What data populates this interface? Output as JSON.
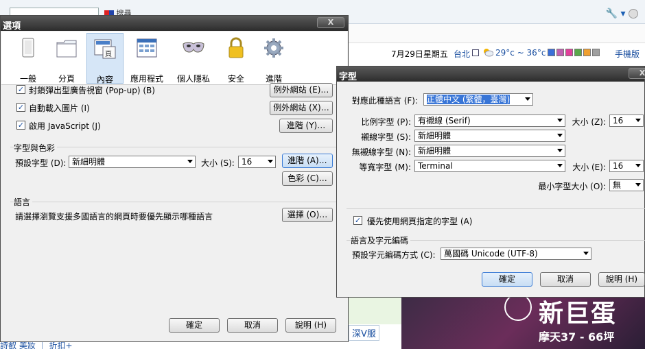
{
  "background": {
    "tab_label": "搜尋",
    "date": "7月29日星期五",
    "city": "台北",
    "temperature": "29°c ~ 36°c",
    "mobile_link": "手機版",
    "ad_headline": "新巨蛋",
    "ad_subline": "摩天37 - 66坪",
    "link_text": "深V服",
    "bottom_text": "詩叡 美妝 ｜ 折扣+",
    "swatch_colors": [
      "#3a6fd8",
      "#c060b0",
      "#e0409a",
      "#5aa84a",
      "#f0a030",
      "#a0a0a0"
    ]
  },
  "options": {
    "title": "選項",
    "close": "X",
    "tabs": [
      {
        "label": "一般",
        "icon": "general-icon"
      },
      {
        "label": "分頁",
        "icon": "tabs-icon"
      },
      {
        "label": "內容",
        "icon": "content-icon"
      },
      {
        "label": "應用程式",
        "icon": "applications-icon"
      },
      {
        "label": "個人隱私",
        "icon": "privacy-mask-icon"
      },
      {
        "label": "安全",
        "icon": "lock-icon"
      },
      {
        "label": "進階",
        "icon": "gear-icon"
      }
    ],
    "block_popups": "封鎖彈出型廣告視窗 (Pop-up) (B)",
    "load_images": "自動載入圖片 (I)",
    "enable_js": "啟用 JavaScript (J)",
    "exceptions_e": "例外網站 (E)…",
    "exceptions_x": "例外網站 (X)…",
    "advanced_y": "進階 (Y)…",
    "fonts_group": "字型與色彩",
    "default_font_label": "預設字型 (D):",
    "default_font": "新細明體",
    "size_label": "大小 (S):",
    "size": "16",
    "advanced_a": "進階 (A)…",
    "colors": "色彩 (C)…",
    "lang_group": "語言",
    "lang_desc": "請選擇瀏覽支援多國語言的網頁時要優先顯示哪種語言",
    "choose": "選擇 (O)…",
    "ok": "確定",
    "cancel": "取消",
    "help": "說明 (H)"
  },
  "fonts": {
    "title": "字型",
    "close": "X",
    "lang_label": "對應此種語言 (F):",
    "lang_value": "正體中文 (繁體，臺灣)",
    "proportional_label": "比例字型 (P):",
    "proportional": "有襯線 (Serif)",
    "size_z_label": "大小 (Z):",
    "size_z": "16",
    "serif_label": "襯線字型 (S):",
    "serif": "新細明體",
    "sans_label": "無襯線字型 (N):",
    "sans": "新細明體",
    "mono_label": "等寬字型 (M):",
    "mono": "Terminal",
    "size_e_label": "大小 (E):",
    "size_e": "16",
    "min_size_label": "最小字型大小 (O):",
    "min_size": "無",
    "allow_page_fonts": "優先使用網頁指定的字型 (A)",
    "encoding_group": "語言及字元編碼",
    "encoding_label": "預設字元編碼方式 (C):",
    "encoding": "萬國碼 Unicode (UTF-8)",
    "ok": "確定",
    "cancel": "取消",
    "help": "說明 (H)"
  }
}
